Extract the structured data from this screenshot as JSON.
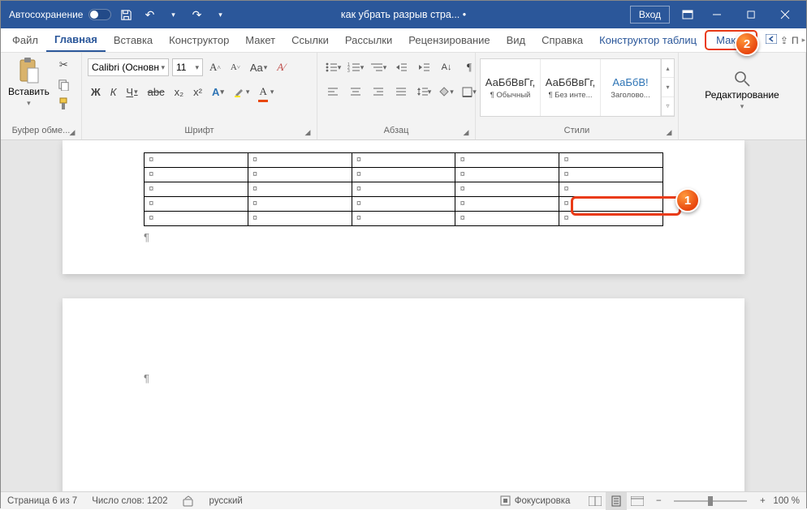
{
  "titlebar": {
    "autosave_label": "Автосохранение",
    "doc_title": "как убрать разрыв стра...  •",
    "signin": "Вход"
  },
  "tabs": {
    "file": "Файл",
    "home": "Главная",
    "insert": "Вставка",
    "design": "Конструктор",
    "layout": "Макет",
    "references": "Ссылки",
    "mailings": "Рассылки",
    "review": "Рецензирование",
    "view": "Вид",
    "help": "Справка",
    "table_design": "Конструктор таблиц",
    "table_layout": "Макет",
    "share_short": "П"
  },
  "ribbon": {
    "clipboard": {
      "paste": "Вставить",
      "label": "Буфер обме..."
    },
    "font": {
      "name": "Calibri (Основн",
      "size": "11",
      "label": "Шрифт",
      "bold": "Ж",
      "italic": "К",
      "underline": "Ч",
      "strike": "abc",
      "sub": "x₂",
      "sup": "x²",
      "inc": "A˄",
      "dec": "A˅",
      "case": "Aa",
      "clear": "A"
    },
    "paragraph": {
      "label": "Абзац"
    },
    "styles": {
      "label": "Стили",
      "items": [
        {
          "preview": "АаБбВвГг,",
          "name": "¶ Обычный"
        },
        {
          "preview": "АаБбВвГг,",
          "name": "¶ Без инте..."
        },
        {
          "preview": "АаБбВ!",
          "name": "Заголово..."
        }
      ]
    },
    "editing": {
      "label": "Редактирование"
    }
  },
  "document": {
    "cell_mark": "¤",
    "para_mark": "¶"
  },
  "status": {
    "page": "Страница 6 из 7",
    "words": "Число слов: 1202",
    "lang": "русский",
    "focus": "Фокусировка",
    "zoom": "100 %"
  },
  "callouts": {
    "one": "1",
    "two": "2"
  }
}
